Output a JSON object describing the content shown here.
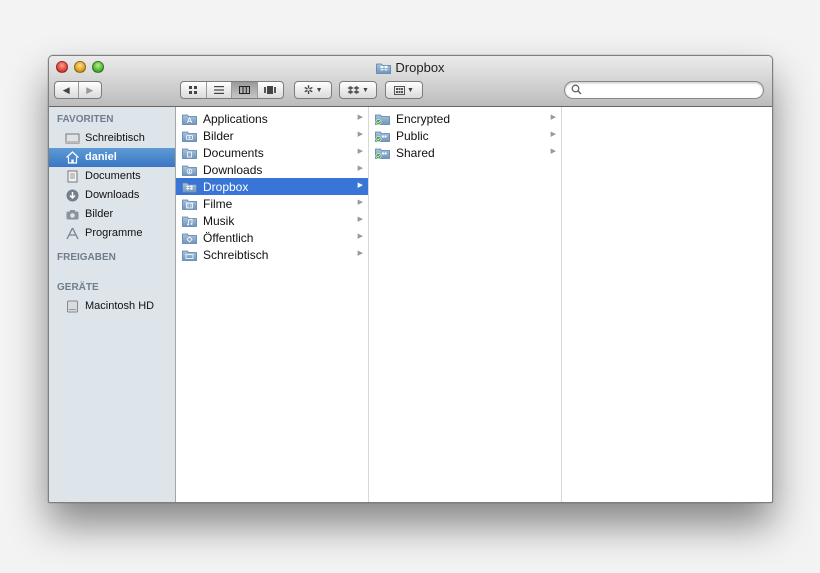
{
  "window": {
    "title": "Dropbox"
  },
  "toolbar": {
    "nav": {
      "back": "◀",
      "forward": "▶"
    },
    "view_modes": [
      "icon-view-icon",
      "list-view-icon",
      "column-view-icon",
      "coverflow-view-icon"
    ],
    "search": {
      "value": "",
      "placeholder": ""
    }
  },
  "sidebar": {
    "favorites_header": "FAVORITEN",
    "favorites": [
      {
        "label": "Schreibtisch",
        "icon": "desktop-icon"
      },
      {
        "label": "daniel",
        "icon": "home-icon"
      },
      {
        "label": "Documents",
        "icon": "documents-icon"
      },
      {
        "label": "Downloads",
        "icon": "downloads-icon"
      },
      {
        "label": "Bilder",
        "icon": "camera-icon"
      },
      {
        "label": "Programme",
        "icon": "applications-icon"
      }
    ],
    "shared_header": "FREIGABEN",
    "devices_header": "GERÄTE",
    "devices": [
      {
        "label": "Macintosh HD",
        "icon": "harddisk-icon"
      }
    ]
  },
  "columns": {
    "home": [
      {
        "label": "Applications",
        "icon": "applications-folder-icon"
      },
      {
        "label": "Bilder",
        "icon": "pictures-folder-icon"
      },
      {
        "label": "Documents",
        "icon": "documents-folder-icon"
      },
      {
        "label": "Downloads",
        "icon": "downloads-folder-icon"
      },
      {
        "label": "Dropbox",
        "icon": "dropbox-folder-icon"
      },
      {
        "label": "Filme",
        "icon": "movies-folder-icon"
      },
      {
        "label": "Musik",
        "icon": "music-folder-icon"
      },
      {
        "label": "Öffentlich",
        "icon": "public-folder-icon"
      },
      {
        "label": "Schreibtisch",
        "icon": "desktop-folder-icon"
      }
    ],
    "dropbox": [
      {
        "label": "Encrypted",
        "icon": "synced-folder-icon"
      },
      {
        "label": "Public",
        "icon": "synced-shared-folder-icon"
      },
      {
        "label": "Shared",
        "icon": "synced-shared-folder-icon"
      }
    ]
  },
  "colors": {
    "selection": "#3875d7",
    "sidebar_bg": "#dde4ea",
    "sidebar_selection": "#4a86cc"
  }
}
